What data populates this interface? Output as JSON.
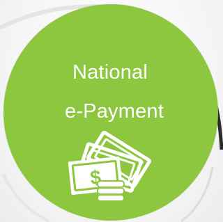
{
  "badge": {
    "title_line_1": "National",
    "title_line_2": "e-Payment",
    "icon": "money-stack-icon",
    "colors": {
      "badge_fill": "#8dc63f",
      "text": "#ffffff",
      "background": "#f6f6f6"
    }
  }
}
